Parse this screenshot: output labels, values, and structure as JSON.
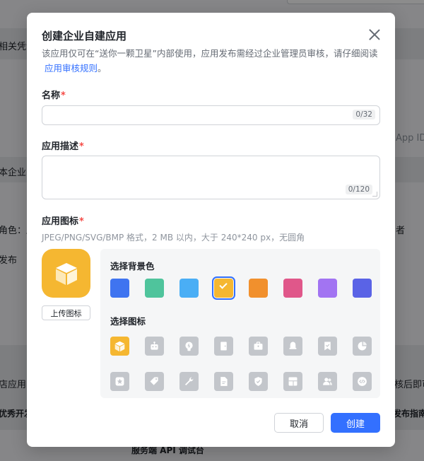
{
  "background": {
    "top_left_text": "相关凭证",
    "mid_left_text": "本企业内",
    "role_text": "角色：所",
    "publish_text": "发布",
    "app_text": "店应用",
    "dev_text": "优秀开发",
    "app_id_text": "App ID",
    "admin_text": "者",
    "after_text": "核后即可",
    "guide_text": "发布指南",
    "api_text": "服务端 API 调试台"
  },
  "modal": {
    "title": "创建企业自建应用",
    "description_prefix": "该应用仅可在“送你一颗卫星”内部使用，应用发布需经过企业管理员审核，请仔细阅读",
    "description_link": "应用审核规则",
    "description_suffix": "。",
    "name_label": "名称",
    "name_value": "",
    "name_counter": "0/32",
    "desc_label": "应用描述",
    "desc_value": "",
    "desc_counter": "0/120",
    "icon_label": "应用图标",
    "required_mark": "*",
    "icon_hint": "JPEG/PNG/SVG/BMP 格式，2 MB 以内，大于 240*240 px，无圆角",
    "upload_label": "上传图标",
    "bg_color_label": "选择背景色",
    "icon_picker_label": "选择图标",
    "colors": [
      "#3f74f0",
      "#4fc49c",
      "#4aaef5",
      "#f5b731",
      "#f1902d",
      "#e0578a",
      "#a274f2",
      "#5a63e6"
    ],
    "selected_color_index": 3,
    "icons_row1": [
      "cube-icon",
      "robot-icon",
      "lightbulb-icon",
      "door-icon",
      "briefcase-icon",
      "bell-icon",
      "bookmark-icon",
      "pie-chart-icon"
    ],
    "icons_row2": [
      "star-badge-icon",
      "tag-icon",
      "wrench-icon",
      "document-icon",
      "shield-check-icon",
      "layout-icon",
      "users-icon",
      "code-icon"
    ],
    "cancel_label": "取消",
    "create_label": "创建"
  }
}
